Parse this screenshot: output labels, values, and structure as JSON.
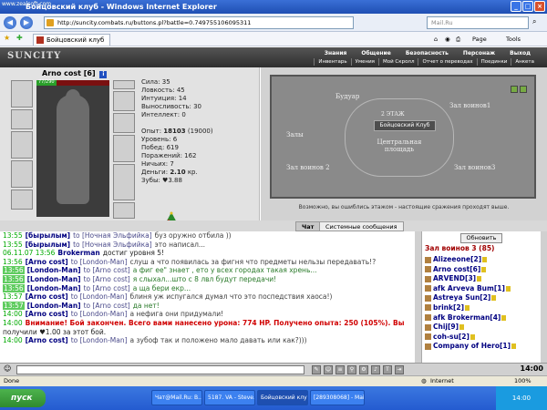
{
  "window": {
    "watermark": "www.zealsoft.com",
    "title": "Бойцовский клуб - Windows Internet Explorer"
  },
  "browser": {
    "url": "http://suncity.combats.ru/buttons.pl?battle=0.749755106095311",
    "search_placeholder": "Mail.Ru",
    "tab_label": "Бойцовский клуб",
    "page_menu": "Page",
    "tools_menu": "Tools"
  },
  "game": {
    "logo": "SUNCITY",
    "menu": [
      "Знания",
      "Общение",
      "Безопасность",
      "Персонаж",
      "Выход"
    ],
    "submenu": [
      "Инвентарь",
      "Умения",
      "Мой Скролл",
      "Отчет о переводах",
      "Поединки",
      "Анкета"
    ]
  },
  "character": {
    "name": "Arno cost",
    "level": "[6]",
    "hp": "77/290",
    "hp_fraction": 0.27,
    "stats": [
      "Сила: 35",
      "Ловкость: 45",
      "Интуиция: 14",
      "Выносливость: 30",
      "Интеллект: 0"
    ],
    "experience_label": "Опыт:",
    "experience": "18103",
    "experience_next": "(19000)",
    "level_line": "Уровень: 6",
    "wins": "Побед: 619",
    "losses": "Поражений: 162",
    "draws": "Ничьих: 7",
    "money_label": "Деньги:",
    "money": "2.10",
    "money_unit": "кр.",
    "teeth": "Зубы: ♥3.88"
  },
  "map": {
    "buildings": [
      "Будуар",
      "Зал воинов1",
      "Залы",
      "Центральная площадь",
      "Зал воинов 2",
      "Зал воинов3"
    ],
    "plate": "Бойцовский Клуб",
    "floor": "2 ЭТАЖ",
    "tip": "Возможно, вы ошиблись этажом - настоящие сражения проходят выше."
  },
  "chat": {
    "tabs": [
      "Чат",
      "Системные сообщения"
    ],
    "lines": [
      {
        "ts": "13:55",
        "hi": false,
        "nick": "[бырылым]",
        "to": "to [Ночная Эльфийка]",
        "msg": "буз оружно отбила ))",
        "cls": "msg"
      },
      {
        "ts": "13:55",
        "hi": false,
        "nick": "[бырылым]",
        "to": "to [Ночная Эльфийка]",
        "msg": "это написал...",
        "cls": "msg"
      },
      {
        "ts": "06.11.07 13:56",
        "hi": false,
        "nick": "Brokerman",
        "to": "",
        "msg": "достиг уровня 5!",
        "cls": "msg sys"
      },
      {
        "ts": "13:56",
        "hi": false,
        "nick": "[Arno cost]",
        "to": "to [London-Man]",
        "msg": "слуш а что появилась за фигня что предметы нельзы передавать!?",
        "cls": "msg"
      },
      {
        "ts": "13:56",
        "hi": true,
        "nick": "[London-Man]",
        "to": "to [Arno cost]",
        "msg": "а фиг ее\" знает , ето у всех городах такая хрень...",
        "cls": "msg grn"
      },
      {
        "ts": "13:56",
        "hi": true,
        "nick": "[London-Man]",
        "to": "to [Arno cost]",
        "msg": "я слыхал...што с 8 лвл будут передачи!",
        "cls": "msg grn"
      },
      {
        "ts": "13:56",
        "hi": true,
        "nick": "[London-Man]",
        "to": "to [Arno cost]",
        "msg": "а ща бери екр...",
        "cls": "msg grn"
      },
      {
        "ts": "13:57",
        "hi": false,
        "nick": "[Arno cost]",
        "to": "to [London-Man]",
        "msg": "блиня уж испугался думал что это поспедствия хаоса!)",
        "cls": "msg"
      },
      {
        "ts": "13:57",
        "hi": true,
        "nick": "[London-Man]",
        "to": "to [Arno cost]",
        "msg": "да нет!",
        "cls": "msg grn"
      },
      {
        "ts": "14:00",
        "hi": false,
        "nick": "[Arno cost]",
        "to": "to [London-Man]",
        "msg": "а нефига они придумали!",
        "cls": "msg"
      },
      {
        "ts": "14:00",
        "hi": false,
        "nick": "",
        "to": "",
        "msg": "Внимание! Бой закончен. Всего вами нанесено урона: 774 HP. Получено опыта: 250 (105%). Вы",
        "cls": "msg red"
      },
      {
        "ts": "",
        "hi": false,
        "nick": "",
        "to": "",
        "msg": "получили ♥1.00 за этот бой.",
        "cls": "msg sys"
      },
      {
        "ts": "14:00",
        "hi": false,
        "nick": "[Arno cost]",
        "to": "to [London-Man]",
        "msg": "а зубоф так и положено мало давать или как?)))",
        "cls": "msg"
      }
    ]
  },
  "users": {
    "refresh_label": "Обновить",
    "room_title": "Зал воинов 3 (85)",
    "list": [
      "Alizeeone[2]",
      "Arno cost[6]",
      "ARVEND[3]",
      "afk Arveva Bum[1]",
      "Astreya Sun[2]",
      "brink[2]",
      "afk Brokerman[4]",
      "Chij[9]",
      "coh-su[2]",
      "Company of Hero[1]"
    ]
  },
  "inputbar": {
    "clock": "14:00"
  },
  "status": {
    "left": "Done",
    "zone": "Internet",
    "zoom": "100%"
  },
  "taskbar": {
    "start": "пуск",
    "tasks": [
      "Чат@Mail.Ru: В...",
      "5187. VA - Steve...",
      "Бойцовский клу...",
      "[289308068] - Mail..."
    ],
    "clock": "14:00"
  }
}
